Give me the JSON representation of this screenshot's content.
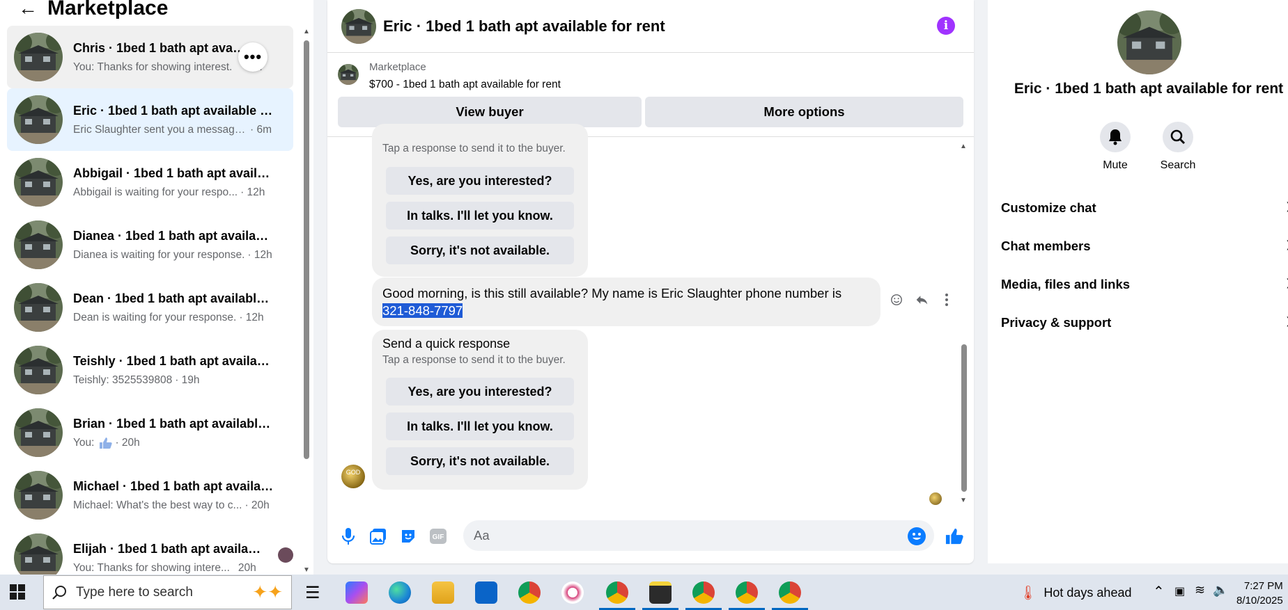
{
  "left": {
    "title": "Marketplace",
    "conversations": [
      {
        "name": "Chris · 1bed 1 bath apt available for rent",
        "snippet": "You: Thanks for showing interest.",
        "time": "m"
      },
      {
        "name": "Eric · 1bed 1 bath apt available for rent",
        "snippet": "Eric Slaughter sent you a message ...",
        "time": "· 6m"
      },
      {
        "name": "Abbigail · 1bed 1 bath apt available for rent",
        "snippet": "Abbigail is waiting for your respo...",
        "time": "· 12h"
      },
      {
        "name": "Dianea · 1bed 1 bath apt available for rent",
        "snippet": "Dianea is waiting for your response.",
        "time": "· 12h"
      },
      {
        "name": "Dean · 1bed 1 bath apt available for rent",
        "snippet": "Dean is waiting for your response.",
        "time": "· 12h"
      },
      {
        "name": "Teishly · 1bed 1 bath apt available for rent",
        "snippet": "Teishly: 3525539808",
        "time": "· 19h"
      },
      {
        "name": "Brian · 1bed 1 bath apt available for rent",
        "snippet": "You:",
        "time": "· 20h"
      },
      {
        "name": "Michael · 1bed 1 bath apt available for rent",
        "snippet": "Michael: What's the best way to c...",
        "time": "· 20h"
      },
      {
        "name": "Elijah · 1bed 1 bath apt available for rent",
        "snippet": "You: Thanks for showing intere...",
        "time": "20h"
      }
    ]
  },
  "chat": {
    "title": "Eric · 1bed 1 bath apt available for rent",
    "listing_source": "Marketplace",
    "listing_title": "$700 - 1bed 1 bath apt available for rent",
    "view_buyer": "View buyer",
    "more_options": "More options",
    "quick_reply_sub": "Tap a response to send it to the buyer.",
    "quick_reply_title": "Send a quick response",
    "quick_replies": [
      "Yes, are you interested?",
      "In talks. I'll let you know.",
      "Sorry, it's not available."
    ],
    "message_text": "Good morning, is this still available? My name is Eric Slaughter phone number is",
    "message_phone": "321-848-7797",
    "sender_avatar_text": "GOD",
    "composer_placeholder": "Aa"
  },
  "right": {
    "title": "Eric · 1bed 1 bath apt available for rent",
    "mute": "Mute",
    "search": "Search",
    "sections": [
      "Customize chat",
      "Chat members",
      "Media, files and links",
      "Privacy & support"
    ]
  },
  "taskbar": {
    "search_placeholder": "Type here to search",
    "weather": "Hot days ahead",
    "time": "7:27 PM",
    "date": "8/10/2025"
  },
  "colors": {
    "accent": "#0a7cff",
    "info": "#a033ff",
    "active_conv": "#e7f3ff",
    "selection": "#1f5bd6"
  }
}
